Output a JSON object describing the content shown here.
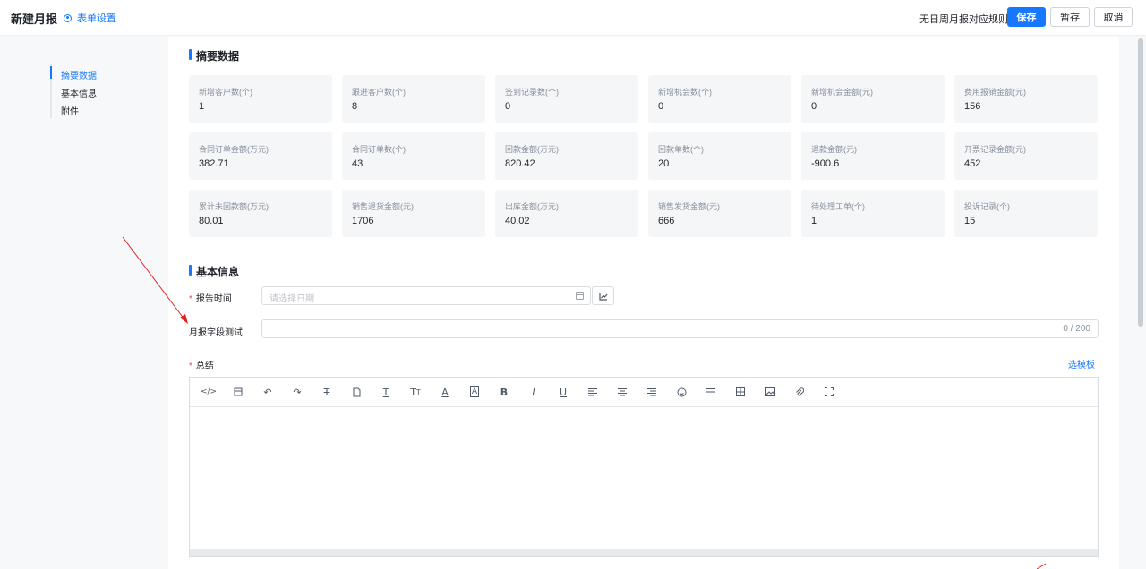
{
  "header": {
    "title": "新建月报",
    "form_settings": "表单设置",
    "warning": "无日周月报对应规则!",
    "save_label": "保存",
    "draft_label": "暂存",
    "cancel_label": "取消"
  },
  "sidenav": {
    "items": [
      {
        "label": "摘要数据"
      },
      {
        "label": "基本信息"
      },
      {
        "label": "附件"
      }
    ]
  },
  "summary": {
    "title": "摘要数据",
    "cards": [
      {
        "label": "新增客户数(个)",
        "value": "1"
      },
      {
        "label": "跟进客户数(个)",
        "value": "8"
      },
      {
        "label": "签到记录数(个)",
        "value": "0"
      },
      {
        "label": "新增机会数(个)",
        "value": "0"
      },
      {
        "label": "新增机会金额(元)",
        "value": "0"
      },
      {
        "label": "费用报销金额(元)",
        "value": "156"
      },
      {
        "label": "合同订单金额(万元)",
        "value": "382.71"
      },
      {
        "label": "合同订单数(个)",
        "value": "43"
      },
      {
        "label": "回款金额(万元)",
        "value": "820.42"
      },
      {
        "label": "回款单数(个)",
        "value": "20"
      },
      {
        "label": "退款金额(元)",
        "value": "-900.6"
      },
      {
        "label": "开票记录金额(元)",
        "value": "452"
      },
      {
        "label": "累计未回款额(万元)",
        "value": "80.01"
      },
      {
        "label": "销售退货金额(元)",
        "value": "1706"
      },
      {
        "label": "出库金额(万元)",
        "value": "40.02"
      },
      {
        "label": "销售发货金额(元)",
        "value": "666"
      },
      {
        "label": "待处理工单(个)",
        "value": "1"
      },
      {
        "label": "投诉记录(个)",
        "value": "15"
      }
    ]
  },
  "basic": {
    "title": "基本信息",
    "report_time_label": "报告时间",
    "report_time_placeholder": "请选择日期",
    "test_field_label": "月报字段测试",
    "test_field_counter": "0 / 200",
    "summary_label": "总结",
    "template_link": "选模板"
  },
  "toolbar_icons": [
    "code-icon",
    "template-icon",
    "undo-icon",
    "redo-icon",
    "strikethrough-icon",
    "format-painter-icon",
    "font-size-icon",
    "text-size-icon",
    "font-color-icon",
    "background-color-icon",
    "bold-icon",
    "italic-icon",
    "underline-icon",
    "align-left-icon",
    "align-center-icon",
    "align-right-icon",
    "emoji-icon",
    "line-height-icon",
    "table-icon",
    "image-icon",
    "attachment-icon",
    "fullscreen-icon"
  ],
  "colors": {
    "accent": "#1677ff",
    "required": "#f53f3f",
    "annotation": "#e02020"
  }
}
